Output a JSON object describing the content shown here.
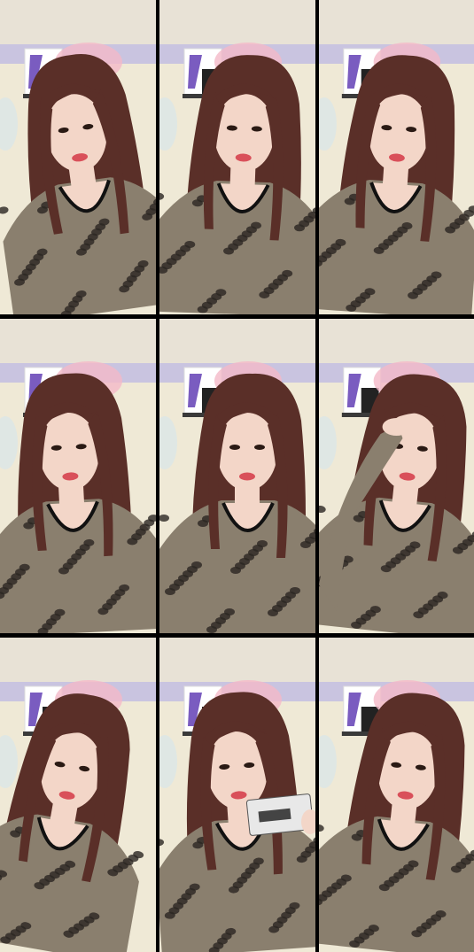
{
  "collage": {
    "rows": 3,
    "cols": 3,
    "frames": [
      {
        "pose": "head-tilt-left",
        "hand": "none"
      },
      {
        "pose": "facing-forward",
        "hand": "none"
      },
      {
        "pose": "slight-tilt",
        "hand": "none"
      },
      {
        "pose": "speaking",
        "hand": "none"
      },
      {
        "pose": "facing-forward",
        "hand": "none"
      },
      {
        "pose": "hand-on-head",
        "hand": "raised"
      },
      {
        "pose": "head-tilt-right",
        "hand": "none"
      },
      {
        "pose": "holding-card",
        "hand": "card"
      },
      {
        "pose": "pout",
        "hand": "none"
      }
    ]
  },
  "colors": {
    "wall": "#efe9d6",
    "ceiling": "#e8e2d6",
    "trim": "#c9c4e0",
    "hair": "#5a2f28",
    "skin": "#f3d6c8",
    "lips": "#d9505a",
    "top_base": "#8a7f6e",
    "top_spots": "#2a2622",
    "flowers": "#f4b9c8",
    "box": "#ffffff"
  }
}
